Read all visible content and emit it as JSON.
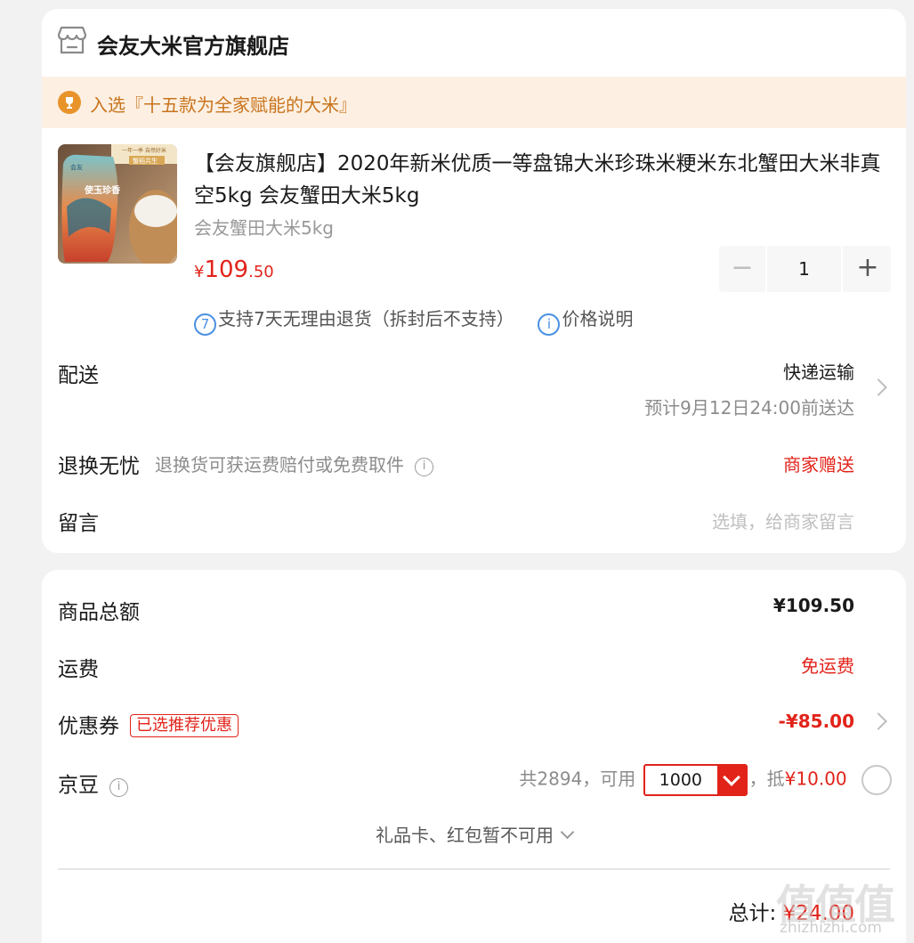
{
  "shop": {
    "name": "会友大米官方旗舰店",
    "icon": "store-icon"
  },
  "promo": {
    "text": "入选『十五款为全家赋能的大米』",
    "icon": "trophy-icon"
  },
  "product": {
    "title": "【会友旗舰店】2020年新米优质一等盘锦大米珍珠米粳米东北蟹田大米非真空5kg 会友蟹田大米5kg",
    "spec": "会友蟹田大米5kg",
    "price_symbol": "¥",
    "price_int": "109",
    "price_dec": ".50",
    "quantity": "1",
    "minus_label": "−",
    "plus_label": "+",
    "image_text_top": "一年一季 自然好米",
    "image_text_banner": "蟹稻共生",
    "image_text_brand": "使玉珍香",
    "image_logo": "会友"
  },
  "service": {
    "return_badge": "7",
    "return_text": "支持7天无理由退货（拆封后不支持）",
    "price_badge": "i",
    "price_text": "价格说明"
  },
  "delivery": {
    "label": "配送",
    "method": "快递运输",
    "eta": "预计9月12日24:00前送达"
  },
  "return_worry": {
    "label": "退换无忧",
    "desc": "退换货可获运费赔付或免费取件",
    "value": "商家赠送"
  },
  "message": {
    "label": "留言",
    "placeholder": "选填，给商家留言"
  },
  "summary": {
    "goods_total_label": "商品总额",
    "goods_total": "¥109.50",
    "shipping_label": "运费",
    "shipping_value": "免运费",
    "coupon_label": "优惠券",
    "coupon_tag": "已选推荐优惠",
    "coupon_value": "-¥85.00",
    "beans_label": "京豆",
    "beans_available": "共2894，可用",
    "beans_selected": "1000",
    "beans_deduct_prefix": "，抵",
    "beans_deduct": "¥10.00",
    "giftcard_text": "礼品卡、红包暂不可用",
    "total_label": "总计:",
    "total_value": "¥24.00"
  },
  "watermark": {
    "big": "值值值",
    "small": "zhizhizhi.com"
  },
  "colors": {
    "accent_red": "#e2231a",
    "promo_orange": "#c8741d",
    "promo_bg": "#fdf0e3",
    "link_blue": "#4a90e2"
  }
}
